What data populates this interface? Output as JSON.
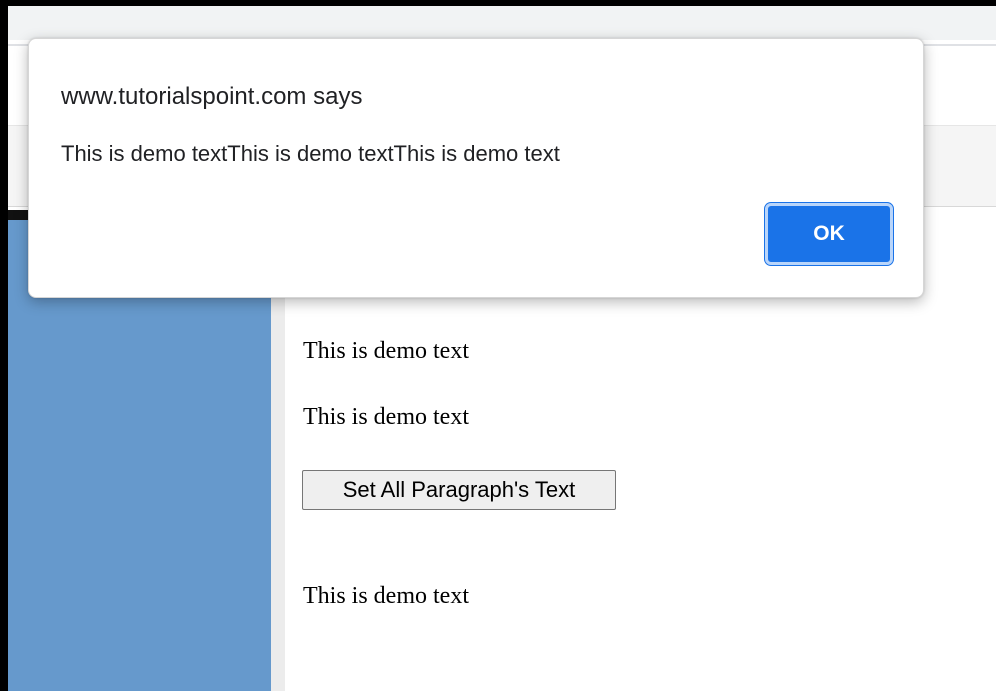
{
  "dialog": {
    "origin": "www.tutorialspoint.com says",
    "message": "This is demo textThis is demo textThis is demo text",
    "ok_label": "OK"
  },
  "page": {
    "paragraphs": [
      "This is demo text",
      "This is demo text",
      "This is demo text"
    ],
    "set_button_label": "Set All Paragraph's Text"
  },
  "colors": {
    "sidebar": "#6699cc",
    "ok_button": "#1a73e8",
    "frame": "#000000"
  }
}
